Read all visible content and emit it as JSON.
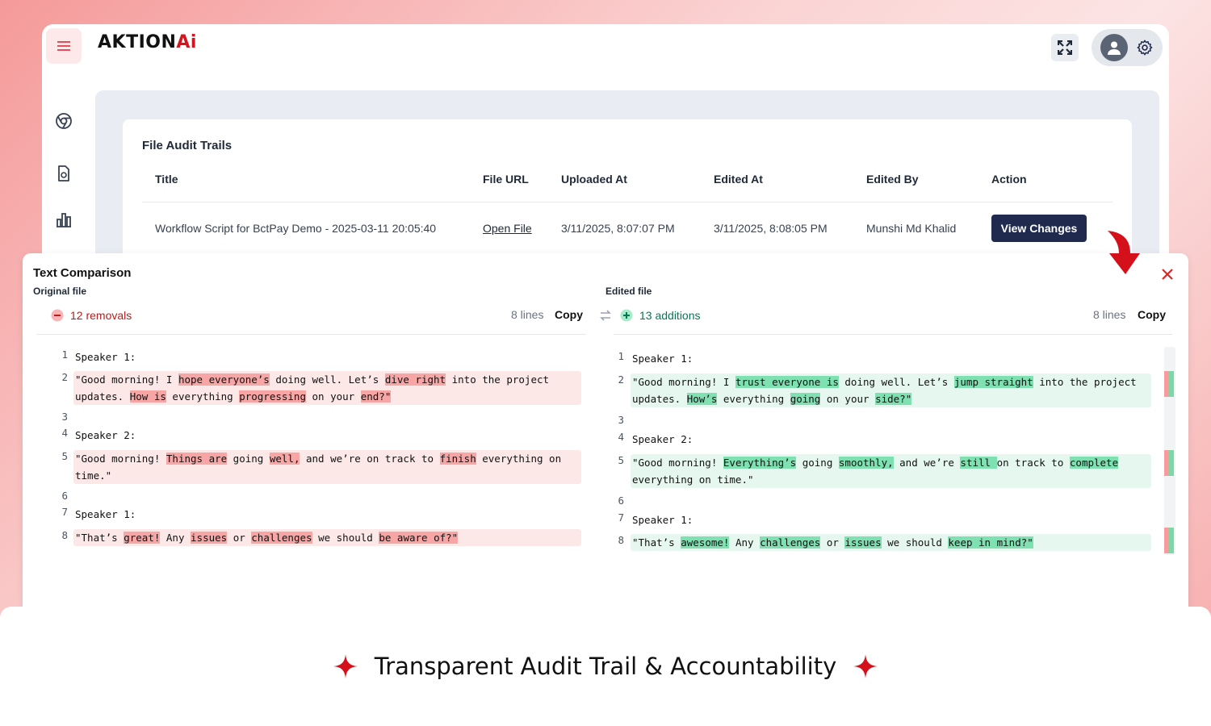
{
  "brand": {
    "logo_text": "AKTION",
    "logo_ai": "Ai",
    "accent": "#d7141d"
  },
  "table": {
    "title": "File Audit Trails",
    "headers": [
      "Title",
      "File URL",
      "Uploaded At",
      "Edited At",
      "Edited By",
      "Action"
    ],
    "row": {
      "title": "Workflow Script for BctPay Demo - 2025-03-11 20:05:40",
      "file_url": "Open File",
      "uploaded_at": "3/11/2025, 8:07:07 PM",
      "edited_at": "3/11/2025, 8:08:05 PM",
      "edited_by": "Munshi Md Khalid",
      "action": "View Changes"
    }
  },
  "comparison": {
    "title": "Text Comparison",
    "original": {
      "label": "Original file",
      "count": "12 removals",
      "lines": "8 lines",
      "copy": "Copy"
    },
    "edited": {
      "label": "Edited file",
      "count": "13 additions",
      "lines": "8 lines",
      "copy": "Copy"
    }
  },
  "footer": {
    "tagline": "Transparent Audit Trail & Accountability"
  }
}
